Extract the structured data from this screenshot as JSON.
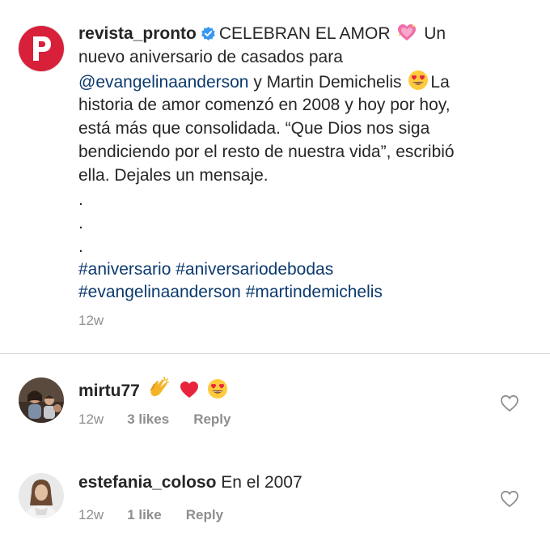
{
  "post": {
    "username": "revista_pronto",
    "caption_line1": "CELEBRAN EL AMOR",
    "caption_line1b": "Un",
    "caption_line2": "nuevo aniversario de casados para",
    "mention": "@evangelinaanderson",
    "caption_line3b": "y Martin Demichelis",
    "caption_line3c": "La",
    "caption_line4": "historia de amor comenzó en 2008 y hoy por hoy,",
    "caption_line5": "está más que consolidada. “Que Dios nos siga",
    "caption_line6": "bendiciendo por el resto de nuestra vida”, escribió",
    "caption_line7": "ella. Dejales un mensaje.",
    "dots": [
      ".",
      ".",
      "."
    ],
    "hashtags_line1": [
      "#aniversario",
      "#aniversariodebodas"
    ],
    "hashtags_line2": [
      "#evangelinaanderson",
      "#martindemichelis"
    ],
    "time": "12w"
  },
  "comments": [
    {
      "username": "mirtu77",
      "text": "",
      "time": "12w",
      "likes": "3 likes",
      "reply": "Reply"
    },
    {
      "username": "estefania_coloso",
      "text": "En el 2007",
      "time": "12w",
      "likes": "1 like",
      "reply": "Reply"
    }
  ],
  "colors": {
    "brand": "#d8203a",
    "link": "#0b3a6e",
    "muted": "#8e8e8e",
    "verified": "#3897f0"
  },
  "icons": [
    "verified-badge-icon",
    "sparkling-heart-emoji",
    "heart-eyes-emoji",
    "clapping-hands-emoji",
    "red-heart-emoji",
    "like-heart-icon"
  ]
}
